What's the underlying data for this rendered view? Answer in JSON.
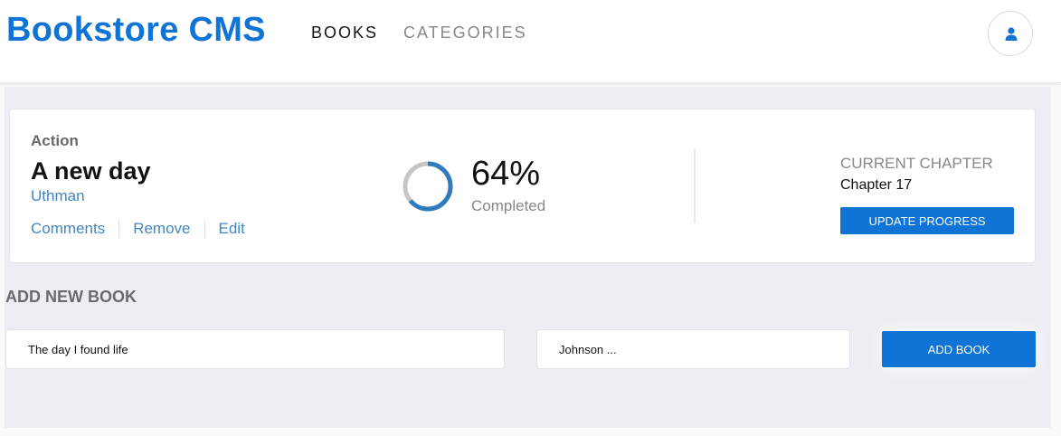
{
  "header": {
    "logo": "Bookstore CMS",
    "nav": [
      {
        "label": "BOOKS",
        "active": true
      },
      {
        "label": "CATEGORIES",
        "active": false
      }
    ],
    "user_icon": "user-icon"
  },
  "book": {
    "genre": "Action",
    "title": "A new day",
    "author": "Uthman",
    "actions": [
      "Comments",
      "Remove",
      "Edit"
    ],
    "progress_percent": 64,
    "progress_text": "64%",
    "progress_label": "Completed",
    "current_chapter_heading": "CURRENT CHAPTER",
    "current_chapter": "Chapter 17",
    "update_label": "UPDATE PROGRESS"
  },
  "form": {
    "heading": "ADD NEW BOOK",
    "title_value": "The day I found life",
    "author_value": "Johnson ...",
    "submit_label": "ADD BOOK"
  },
  "colors": {
    "accent": "#0f74d6",
    "progress_ring": "#307bbe",
    "background": "#edeef3"
  }
}
